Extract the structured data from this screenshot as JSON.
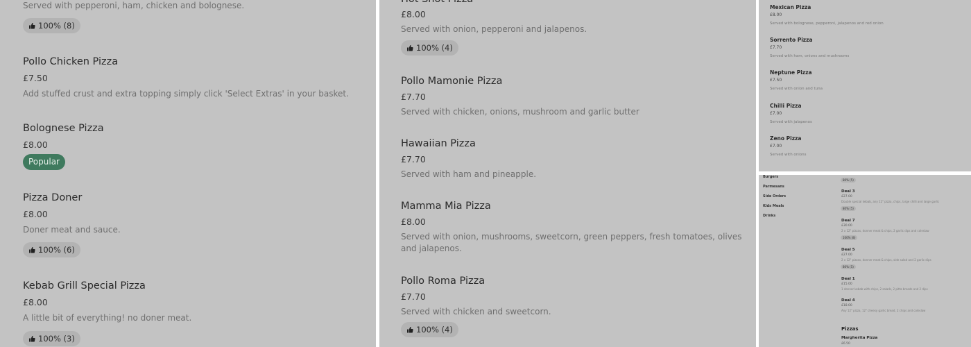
{
  "panel1": {
    "items": [
      {
        "name": "",
        "price": "",
        "desc": "Served with pepperoni, ham, chicken and bolognese.",
        "rating": "100% (8)"
      },
      {
        "name": "Pollo Chicken Pizza",
        "price": "£7.50",
        "desc": "Add stuffed crust and extra topping simply click 'Select Extras' in your basket.",
        "rating": ""
      },
      {
        "name": "Bolognese Pizza",
        "price": "£8.00",
        "desc": "",
        "badge": "Popular"
      },
      {
        "name": "Pizza Doner",
        "price": "£8.00",
        "desc": "Doner meat and sauce.",
        "rating": "100% (6)"
      },
      {
        "name": "Kebab Grill Special Pizza",
        "price": "£8.00",
        "desc": "A little bit of everything! no doner meat.",
        "rating": "100% (3)"
      }
    ]
  },
  "panel2": {
    "items": [
      {
        "name": "Hot Shot Pizza",
        "price": "£8.00",
        "desc": "Served with onion, pepperoni and jalapenos.",
        "rating": "100% (4)"
      },
      {
        "name": "Pollo Mamonie Pizza",
        "price": "£7.70",
        "desc": "Served with chicken, onions, mushroom and garlic butter"
      },
      {
        "name": "Hawaiian Pizza",
        "price": "£7.70",
        "desc": "Served with ham and pineapple."
      },
      {
        "name": "Mamma Mia Pizza",
        "price": "£8.00",
        "desc": "Served with onion, mushrooms, sweetcorn, green peppers, fresh tomatoes, olives and jalapenos."
      },
      {
        "name": "Pollo Roma Pizza",
        "price": "£7.70",
        "desc": "Served with chicken and sweetcorn.",
        "rating": "100% (4)"
      }
    ]
  },
  "panel3": {
    "items": [
      {
        "name": "Mexican Pizza",
        "price": "£8.00",
        "desc": "Served with bolognese, pepperoni, jalapenos and red onion"
      },
      {
        "name": "Sorrento Pizza",
        "price": "£7.70",
        "desc": "Served with ham, onions and mushrooms"
      },
      {
        "name": "Neptune Pizza",
        "price": "£7.50",
        "desc": "Served with onion and tuna"
      },
      {
        "name": "Chilli Pizza",
        "price": "£7.00",
        "desc": "Served with jalapenos"
      },
      {
        "name": "Zeno Pizza",
        "price": "£7.00",
        "desc": "Served with onions"
      }
    ]
  },
  "panel4": {
    "categories": [
      "Burgers",
      "Parmesans",
      "Side Orders",
      "Kids Meals",
      "Drinks"
    ],
    "top_rating": "80% (5)",
    "deals": [
      {
        "name": "Deal 3",
        "price": "£27.00",
        "desc": "Double special kebab, any 12\" pizza, chips, large chilli and large garlic",
        "rating": "80% (5)"
      },
      {
        "name": "Deal 7",
        "price": "£30.00",
        "desc": "2 x 12\" pizzas, donner meat & chips, 2 garlic dips and coleslaw",
        "rating": "100% (8)"
      },
      {
        "name": "Deal 5",
        "price": "£27.00",
        "desc": "2 x 12\" pizzas, donner meat & chips, side salad and 2 garlic dips",
        "rating": "80% (5)"
      },
      {
        "name": "Deal 1",
        "price": "£15.00",
        "desc": "1 donner kebab with chips, 2 salads, 2 pitta breads and 2 dips"
      },
      {
        "name": "Deal 4",
        "price": "£18.00",
        "desc": "Any 12\" pizza, 12\" cheesy garlic bread, 2 chips and coleslaw"
      }
    ],
    "section_title": "Pizzas",
    "next_item": {
      "name": "Margherita Pizza",
      "price": "£6.50"
    }
  }
}
